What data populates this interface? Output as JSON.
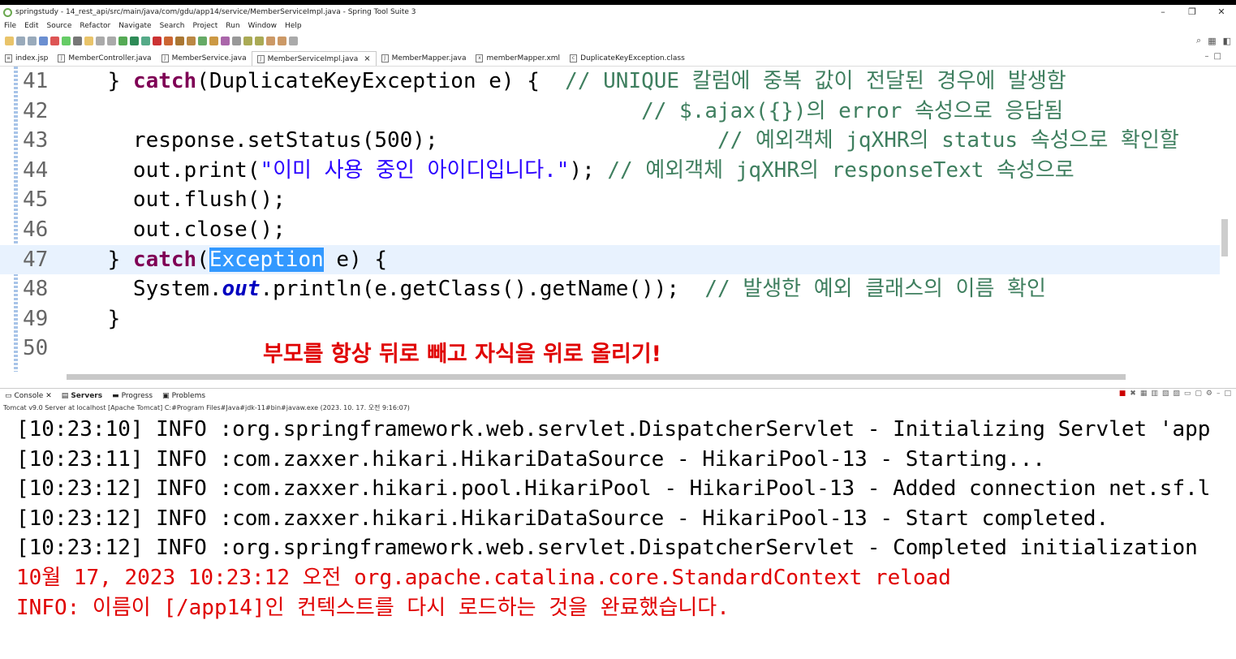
{
  "window": {
    "title": "springstudy - 14_rest_api/src/main/java/com/gdu/app14/service/MemberServiceImpl.java - Spring Tool Suite 3",
    "minimize": "–",
    "maximize": "❐",
    "close": "✕"
  },
  "menu": [
    "File",
    "Edit",
    "Source",
    "Refactor",
    "Navigate",
    "Search",
    "Project",
    "Run",
    "Window",
    "Help"
  ],
  "tabs": [
    {
      "label": "index.jsp",
      "icon": "jsp-file-icon"
    },
    {
      "label": "MemberController.java",
      "icon": "java-file-icon"
    },
    {
      "label": "MemberService.java",
      "icon": "java-file-icon"
    },
    {
      "label": "MemberServiceImpl.java",
      "icon": "java-file-icon",
      "active": true
    },
    {
      "label": "MemberMapper.java",
      "icon": "java-file-icon"
    },
    {
      "label": "memberMapper.xml",
      "icon": "xml-file-icon"
    },
    {
      "label": "DuplicateKeyException.class",
      "icon": "class-file-icon"
    }
  ],
  "editor": {
    "lines": [
      {
        "num": "41",
        "parts": [
          [
            "",
            "} "
          ],
          [
            "kw",
            "catch"
          ],
          [
            "",
            "(DuplicateKeyException e) {  "
          ],
          [
            "cm",
            "// UNIQUE 칼럼에 중복 값이 전달된 경우에 발생함"
          ]
        ]
      },
      {
        "num": "42",
        "parts": [
          [
            "",
            "                                          "
          ],
          [
            "cm",
            "// $.ajax({})의 error 속성으로 응답됨"
          ]
        ]
      },
      {
        "num": "43",
        "parts": [
          [
            "",
            "  response.setStatus(500);                      "
          ],
          [
            "cm",
            "// 예외객체 jqXHR의 status 속성으로 확인할"
          ]
        ]
      },
      {
        "num": "44",
        "parts": [
          [
            "",
            "  out.print("
          ],
          [
            "str",
            "\"이미 사용 중인 아이디입니다.\""
          ],
          [
            "",
            "); "
          ],
          [
            "cm",
            "// 예외객체 jqXHR의 responseText 속성으로"
          ]
        ]
      },
      {
        "num": "45",
        "parts": [
          [
            "",
            "  out.flush();"
          ]
        ]
      },
      {
        "num": "46",
        "parts": [
          [
            "",
            "  out.close();"
          ]
        ]
      },
      {
        "num": "47",
        "current": true,
        "parts": [
          [
            "",
            "} "
          ],
          [
            "kw",
            "catch"
          ],
          [
            "",
            "("
          ],
          [
            "sel",
            "Exception"
          ],
          [
            "",
            " e) {"
          ]
        ]
      },
      {
        "num": "48",
        "parts": [
          [
            "",
            "  System."
          ],
          [
            "it",
            "out"
          ],
          [
            "",
            ".println(e.getClass().getName());  "
          ],
          [
            "cm",
            "// 발생한 예외 클래스의 이름 확인"
          ]
        ]
      },
      {
        "num": "49",
        "parts": [
          [
            "",
            "}"
          ]
        ]
      },
      {
        "num": "50",
        "parts": [
          [
            "",
            ""
          ]
        ]
      }
    ],
    "annotation": "부모를 항상 뒤로 빼고 자식을 위로 올리기!"
  },
  "console": {
    "tabs": [
      {
        "label": "Console",
        "icon": "console-icon",
        "close": "✕"
      },
      {
        "label": "Servers",
        "icon": "servers-icon",
        "bold": true
      },
      {
        "label": "Progress",
        "icon": "progress-icon"
      },
      {
        "label": "Problems",
        "icon": "problems-icon"
      }
    ],
    "description": "Tomcat v9.0 Server at localhost [Apache Tomcat] C:#Program Files#Java#jdk-11#bin#javaw.exe  (2023. 10. 17. 오전 9:16:07)",
    "lines": [
      {
        "text": "[10:23:10] INFO :org.springframework.web.servlet.DispatcherServlet - Initializing Servlet 'app",
        "type": "info"
      },
      {
        "text": "[10:23:11] INFO :com.zaxxer.hikari.HikariDataSource - HikariPool-13 - Starting...",
        "type": "info"
      },
      {
        "text": "[10:23:12] INFO :com.zaxxer.hikari.pool.HikariPool - HikariPool-13 - Added connection net.sf.l",
        "type": "info"
      },
      {
        "text": "[10:23:12] INFO :com.zaxxer.hikari.HikariDataSource - HikariPool-13 - Start completed.",
        "type": "info"
      },
      {
        "text": "[10:23:12] INFO :org.springframework.web.servlet.DispatcherServlet - Completed initialization",
        "type": "info"
      },
      {
        "text": "10월 17, 2023 10:23:12 오전 org.apache.catalina.core.StandardContext reload",
        "type": "err"
      },
      {
        "text": "INFO: 이름이 [/app14]인 컨텍스트를 다시 로드하는 것을 완료했습니다.",
        "type": "err"
      }
    ]
  }
}
